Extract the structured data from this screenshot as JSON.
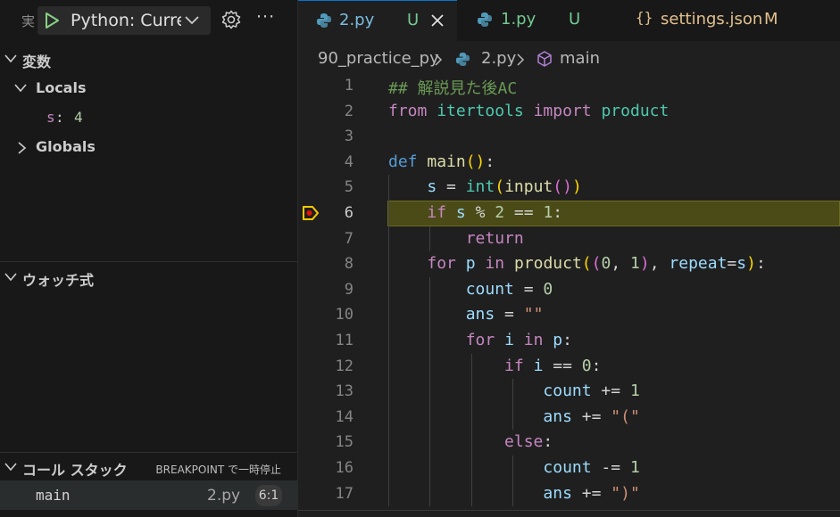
{
  "debug": {
    "run_label": "実",
    "config_name": "Python: Current File",
    "more": "···"
  },
  "sidebar": {
    "variables": {
      "title": "変数",
      "locals_label": "Locals",
      "local_var": {
        "name": "s",
        "sep": ": ",
        "value": "4"
      },
      "globals_label": "Globals"
    },
    "watch": {
      "title": "ウォッチ式"
    },
    "call_stack": {
      "title": "コール スタック",
      "state": "BREAKPOINT で一時停止",
      "frame": {
        "name": "main",
        "file": "2.py",
        "position": "6:1"
      }
    }
  },
  "tabs": [
    {
      "name": "2.py",
      "status": "U",
      "active": true
    },
    {
      "name": "1.py",
      "status": "U",
      "active": false
    },
    {
      "name": "settings.json",
      "status": "M",
      "active": false
    }
  ],
  "breadcrumb": {
    "folder": "90_practice_py",
    "file": "2.py",
    "symbol": "main"
  },
  "editor": {
    "current_line": 6,
    "lines": [
      {
        "n": "1",
        "tokens": [
          [
            "cm",
            "## 解説見た後AC"
          ]
        ]
      },
      {
        "n": "2",
        "tokens": [
          [
            "kw",
            "from"
          ],
          [
            "op",
            " "
          ],
          [
            "bi",
            "itertools"
          ],
          [
            "op",
            " "
          ],
          [
            "kw",
            "import"
          ],
          [
            "op",
            " "
          ],
          [
            "bi",
            "product"
          ]
        ]
      },
      {
        "n": "3",
        "tokens": []
      },
      {
        "n": "4",
        "tokens": [
          [
            "def",
            "def"
          ],
          [
            "op",
            " "
          ],
          [
            "fn",
            "main"
          ],
          [
            "p1",
            "()"
          ],
          [
            "op",
            ":"
          ]
        ]
      },
      {
        "n": "5",
        "tokens": [
          [
            "op",
            "    "
          ],
          [
            "var",
            "s"
          ],
          [
            "op",
            " = "
          ],
          [
            "bi",
            "int"
          ],
          [
            "p1",
            "("
          ],
          [
            "fn",
            "input"
          ],
          [
            "p2",
            "()"
          ],
          [
            "p1",
            ")"
          ]
        ]
      },
      {
        "n": "6",
        "tokens": [
          [
            "op",
            "    "
          ],
          [
            "kw",
            "if"
          ],
          [
            "op",
            " "
          ],
          [
            "var",
            "s"
          ],
          [
            "op",
            " % "
          ],
          [
            "num",
            "2"
          ],
          [
            "op",
            " == "
          ],
          [
            "num",
            "1"
          ],
          [
            "op",
            ":"
          ]
        ]
      },
      {
        "n": "7",
        "tokens": [
          [
            "op",
            "        "
          ],
          [
            "kw",
            "return"
          ]
        ]
      },
      {
        "n": "8",
        "tokens": [
          [
            "op",
            "    "
          ],
          [
            "kw",
            "for"
          ],
          [
            "op",
            " "
          ],
          [
            "var",
            "p"
          ],
          [
            "op",
            " "
          ],
          [
            "kw",
            "in"
          ],
          [
            "op",
            " "
          ],
          [
            "fn",
            "product"
          ],
          [
            "p1",
            "("
          ],
          [
            "p2",
            "("
          ],
          [
            "num",
            "0"
          ],
          [
            "op",
            ", "
          ],
          [
            "num",
            "1"
          ],
          [
            "p2",
            ")"
          ],
          [
            "op",
            ", "
          ],
          [
            "var",
            "repeat"
          ],
          [
            "op",
            "="
          ],
          [
            "var",
            "s"
          ],
          [
            "p1",
            ")"
          ],
          [
            "op",
            ":"
          ]
        ]
      },
      {
        "n": "9",
        "tokens": [
          [
            "op",
            "        "
          ],
          [
            "var",
            "count"
          ],
          [
            "op",
            " = "
          ],
          [
            "num",
            "0"
          ]
        ]
      },
      {
        "n": "10",
        "tokens": [
          [
            "op",
            "        "
          ],
          [
            "var",
            "ans"
          ],
          [
            "op",
            " = "
          ],
          [
            "str",
            "\"\""
          ]
        ]
      },
      {
        "n": "11",
        "tokens": [
          [
            "op",
            "        "
          ],
          [
            "kw",
            "for"
          ],
          [
            "op",
            " "
          ],
          [
            "var",
            "i"
          ],
          [
            "op",
            " "
          ],
          [
            "kw",
            "in"
          ],
          [
            "op",
            " "
          ],
          [
            "var",
            "p"
          ],
          [
            "op",
            ":"
          ]
        ]
      },
      {
        "n": "12",
        "tokens": [
          [
            "op",
            "            "
          ],
          [
            "kw",
            "if"
          ],
          [
            "op",
            " "
          ],
          [
            "var",
            "i"
          ],
          [
            "op",
            " == "
          ],
          [
            "num",
            "0"
          ],
          [
            "op",
            ":"
          ]
        ]
      },
      {
        "n": "13",
        "tokens": [
          [
            "op",
            "                "
          ],
          [
            "var",
            "count"
          ],
          [
            "op",
            " += "
          ],
          [
            "num",
            "1"
          ]
        ]
      },
      {
        "n": "14",
        "tokens": [
          [
            "op",
            "                "
          ],
          [
            "var",
            "ans"
          ],
          [
            "op",
            " += "
          ],
          [
            "str",
            "\"(\""
          ]
        ]
      },
      {
        "n": "15",
        "tokens": [
          [
            "op",
            "            "
          ],
          [
            "kw",
            "else"
          ],
          [
            "op",
            ":"
          ]
        ]
      },
      {
        "n": "16",
        "tokens": [
          [
            "op",
            "                "
          ],
          [
            "var",
            "count"
          ],
          [
            "op",
            " -= "
          ],
          [
            "num",
            "1"
          ]
        ]
      },
      {
        "n": "17",
        "tokens": [
          [
            "op",
            "                "
          ],
          [
            "var",
            "ans"
          ],
          [
            "op",
            " += "
          ],
          [
            "str",
            "\")\""
          ]
        ]
      }
    ]
  }
}
